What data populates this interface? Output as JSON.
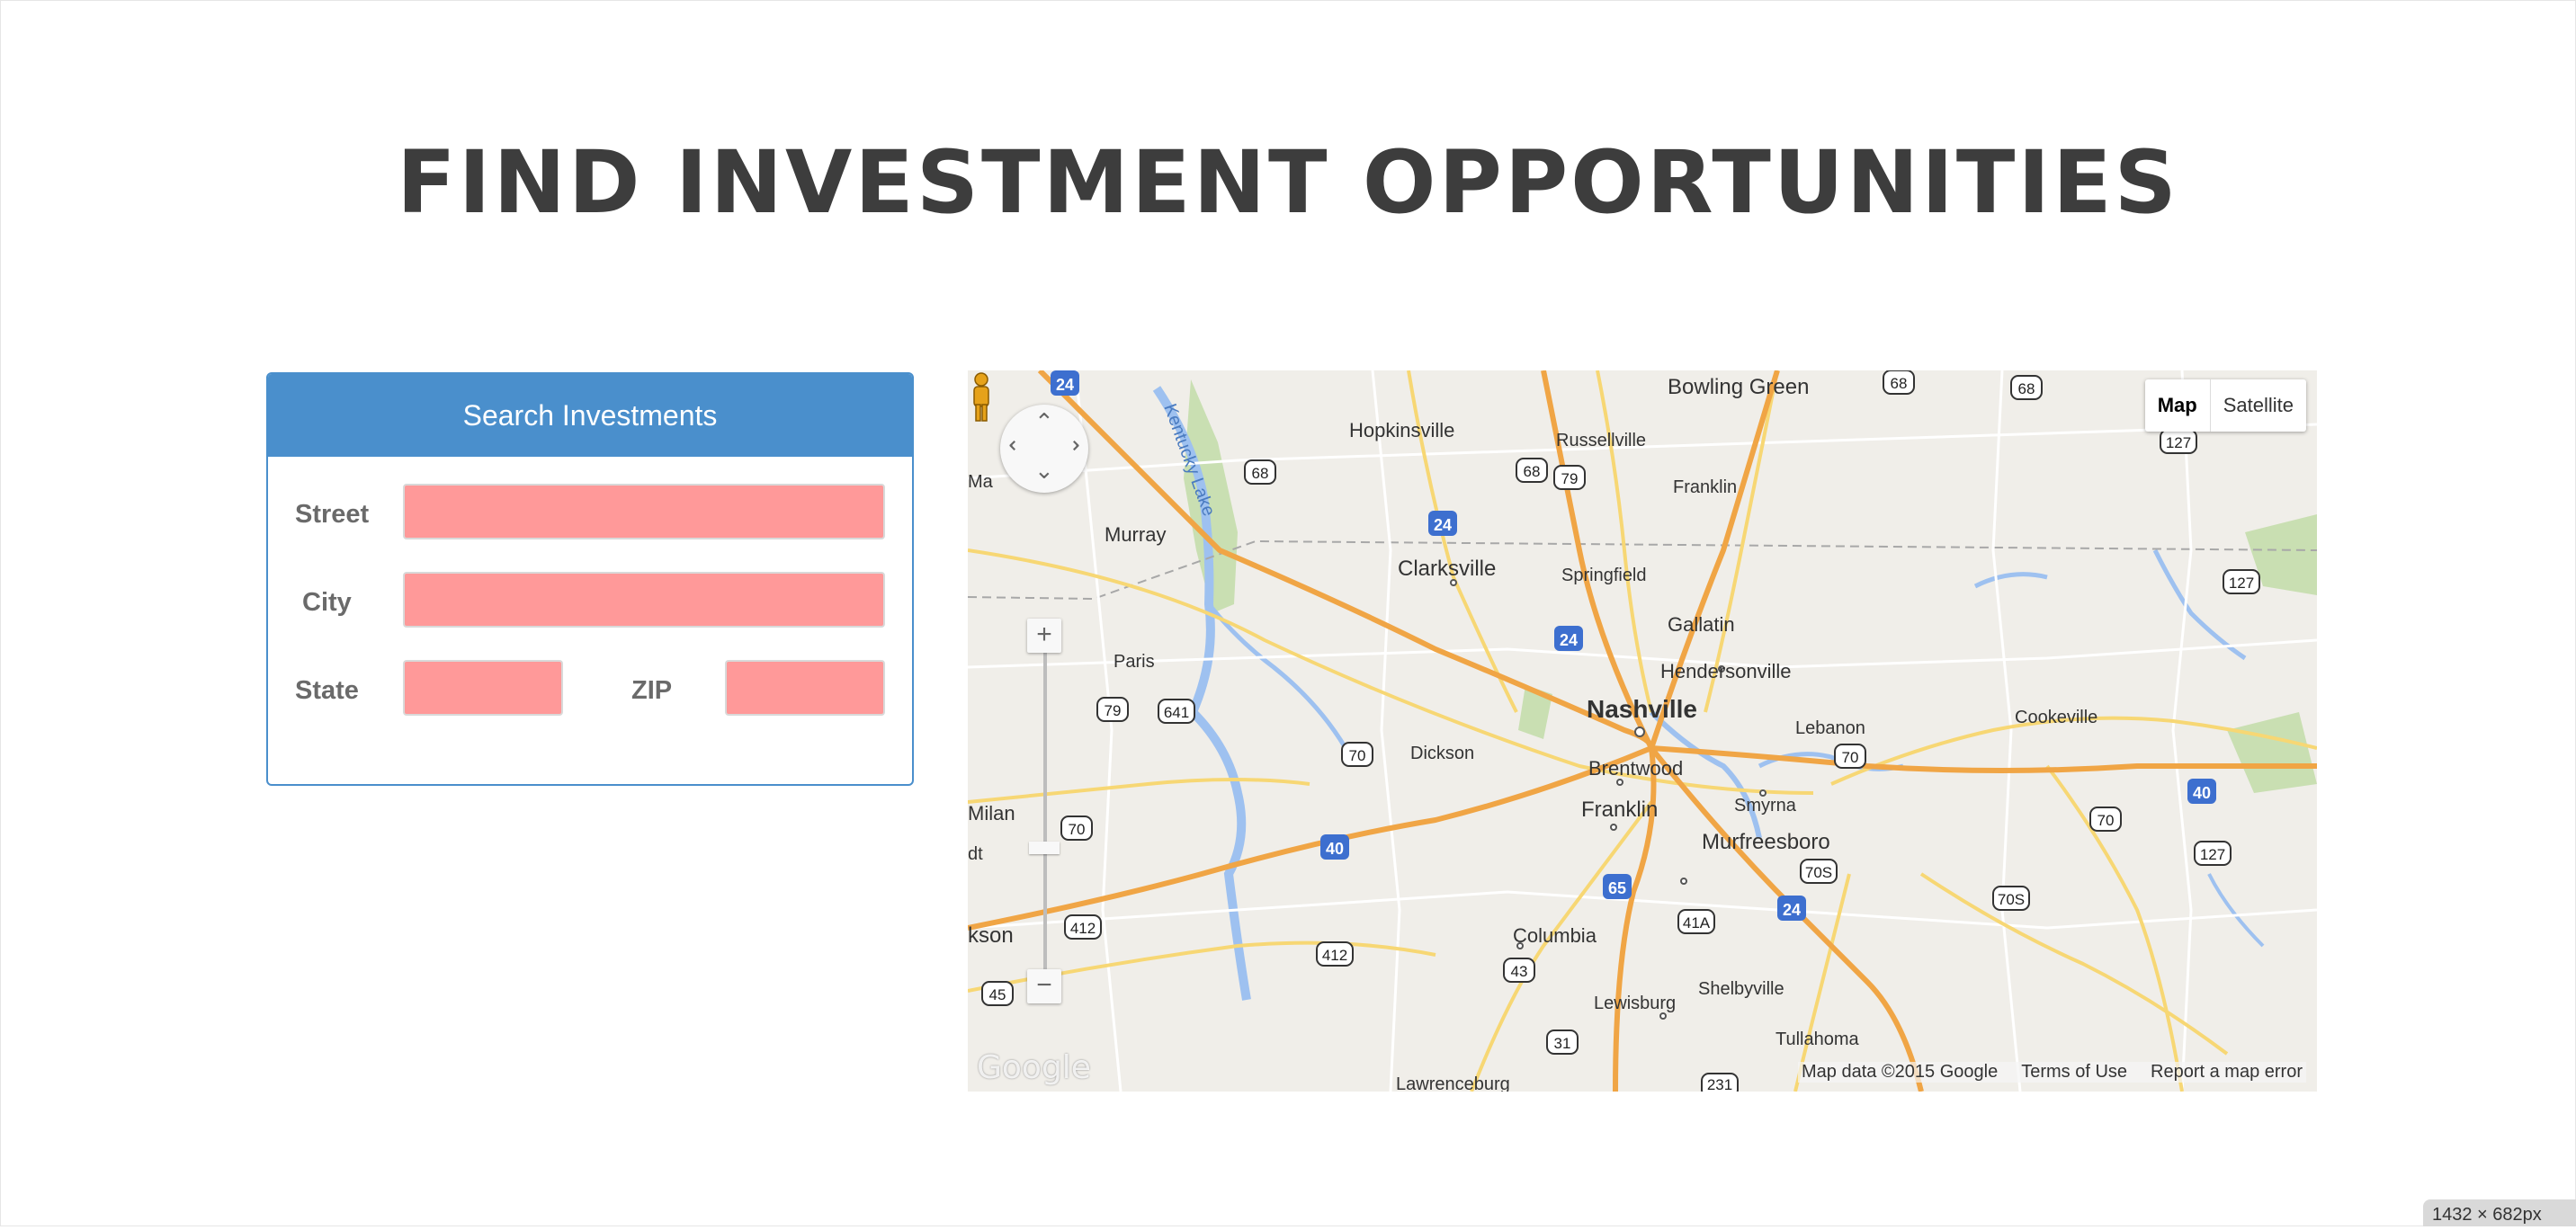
{
  "page": {
    "title": "FIND INVESTMENT OPPORTUNITIES"
  },
  "search_panel": {
    "heading": "Search Investments",
    "fields": {
      "street": {
        "label": "Street",
        "value": ""
      },
      "city": {
        "label": "City",
        "value": ""
      },
      "state": {
        "label": "State",
        "value": ""
      },
      "zip": {
        "label": "ZIP",
        "value": ""
      }
    }
  },
  "map": {
    "type_buttons": {
      "map": "Map",
      "satellite": "Satellite"
    },
    "active_type": "Map",
    "zoom_in": "+",
    "zoom_out": "−",
    "logo": "Google",
    "attribution": {
      "data": "Map data ©2015 Google",
      "terms": "Terms of Use",
      "report": "Report a map error"
    },
    "places": {
      "bowling_green": "Bowling Green",
      "hopkinsville": "Hopkinsville",
      "russellville": "Russellville",
      "franklin_ky": "Franklin",
      "murray": "Murray",
      "clarksville": "Clarksville",
      "springfield": "Springfield",
      "gallatin": "Gallatin",
      "paris": "Paris",
      "hendersonville": "Hendersonville",
      "nashville": "Nashville",
      "lebanon": "Lebanon",
      "cookeville": "Cookeville",
      "dickson": "Dickson",
      "brentwood": "Brentwood",
      "franklin_tn": "Franklin",
      "smyrna": "Smyrna",
      "milan": "Milan",
      "murfreesboro": "Murfreesboro",
      "jackson": "kson",
      "columbia": "Columbia",
      "shelbyville": "Shelbyville",
      "lewisburg": "Lewisburg",
      "tullahoma": "Tullahoma",
      "lawrenceburg": "Lawrenceburg",
      "kentucky_lake": "Kentucky Lake",
      "ma": "Ma",
      "dt": "dt"
    },
    "highway_shields": {
      "i24_nw": "24",
      "us68_top": "68",
      "us68_tr": "68",
      "us68_mid": "68",
      "us68_c": "68",
      "us79_c": "79",
      "i24_hop": "24",
      "us127_t": "127",
      "us127_r": "127",
      "us127_b": "127",
      "i24_c": "24",
      "us79_w": "79",
      "us641": "641",
      "us70_c": "70",
      "us70_e": "70",
      "us70_w": "70",
      "us70_far": "70",
      "i40_w": "40",
      "i40_e": "40",
      "i65": "65",
      "us70s": "70S",
      "us70s_e": "70S",
      "i24_s": "24",
      "us41a": "41A",
      "us412_w": "412",
      "us412_c": "412",
      "us43": "43",
      "us45": "45",
      "us31": "31",
      "us231": "231"
    }
  },
  "screen_size_badge": "1432 × 682px"
}
